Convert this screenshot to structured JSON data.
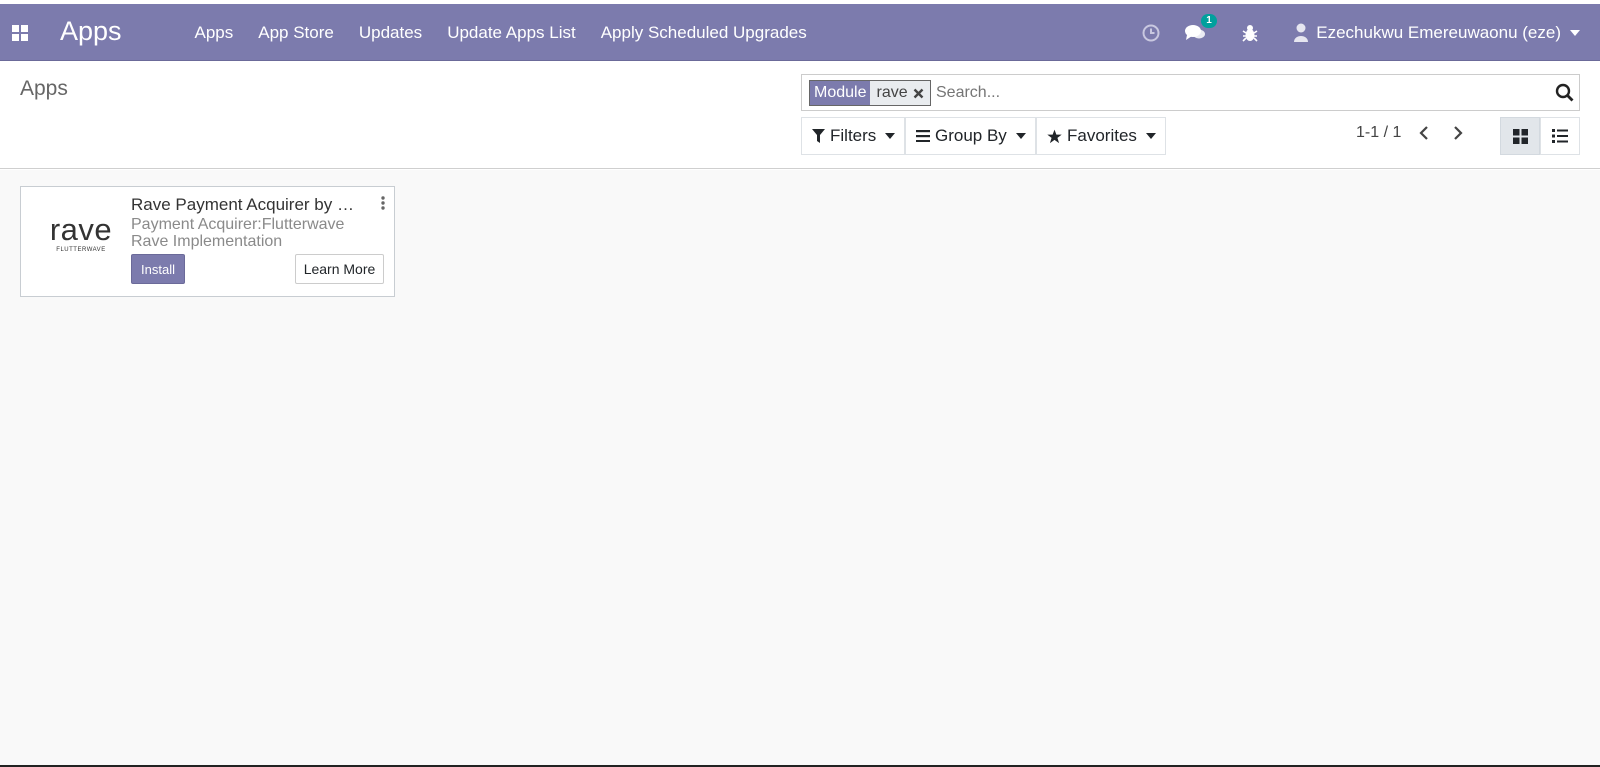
{
  "navbar": {
    "brand": "Apps",
    "menu": [
      "Apps",
      "App Store",
      "Updates",
      "Update Apps List",
      "Apply Scheduled Upgrades"
    ],
    "messages_badge": "1",
    "user_name": "Ezechukwu Emereuwaonu (eze)"
  },
  "control_panel": {
    "breadcrumb": "Apps",
    "search": {
      "facet_label": "Module",
      "facet_value": "rave",
      "placeholder": "Search..."
    },
    "filters_label": "Filters",
    "groupby_label": "Group By",
    "favorites_label": "Favorites",
    "pager": "1-1 / 1"
  },
  "cards": [
    {
      "logo_word": "rave",
      "logo_sub": "FLUTTERWAVE",
      "title": "Rave Payment Acquirer by Flutterwave",
      "summary": "Payment Acquirer:Flutterwave Rave Implementation",
      "install_label": "Install",
      "learn_label": "Learn More"
    }
  ],
  "colors": {
    "brand": "#7c7bad",
    "badge": "#00a09d",
    "background": "#f9f9f9"
  }
}
